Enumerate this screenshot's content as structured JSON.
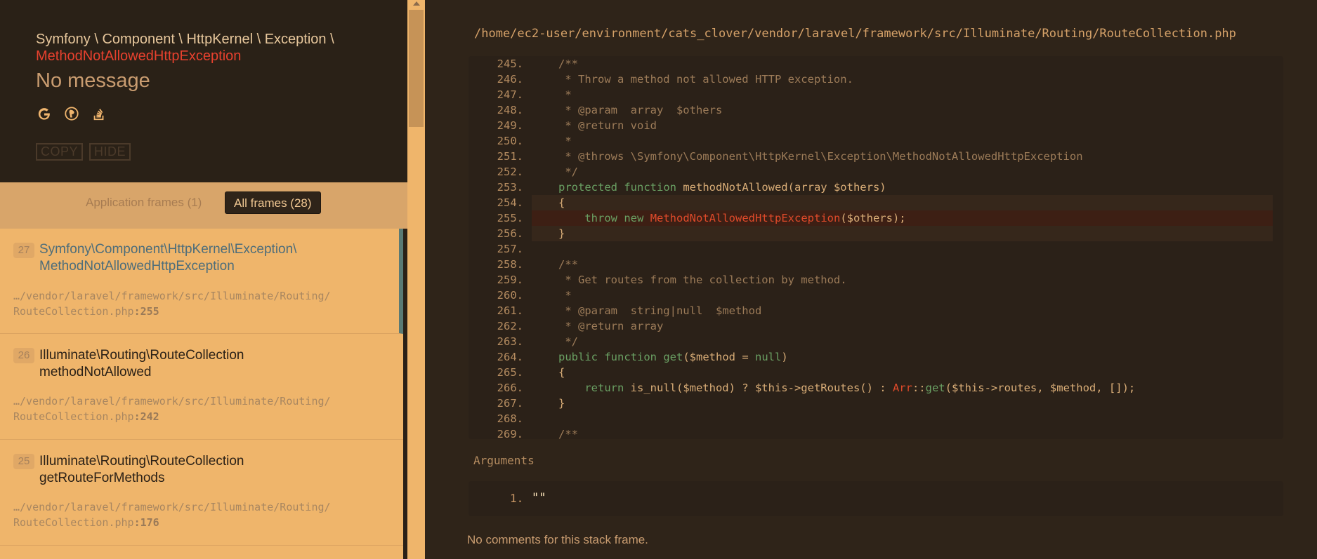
{
  "exception": {
    "namespace": "Symfony \\ Component \\ HttpKernel \\ Exception \\",
    "class": "MethodNotAllowedHttpException",
    "message": "No message"
  },
  "header_icons": [
    "google-search-icon",
    "duckduckgo-search-icon",
    "stackoverflow-search-icon"
  ],
  "buttons": {
    "copy": "COPY",
    "hide": "HIDE"
  },
  "filters": {
    "application": "Application frames (1)",
    "all": "All frames (28)"
  },
  "frames": [
    {
      "num": "27",
      "class": "Symfony\\Component\\HttpKernel\\Exception\\",
      "method": "MethodNotAllowedHttpException",
      "file": "…/vendor/laravel/framework/src/Illuminate/Routing/",
      "file2": "RouteCollection.php",
      "line": ":255"
    },
    {
      "num": "26",
      "class": "Illuminate\\Routing\\RouteCollection",
      "method": "methodNotAllowed",
      "file": "…/vendor/laravel/framework/src/Illuminate/Routing/",
      "file2": "RouteCollection.php",
      "line": ":242"
    },
    {
      "num": "25",
      "class": "Illuminate\\Routing\\RouteCollection",
      "method": "getRouteForMethods",
      "file": "…/vendor/laravel/framework/src/Illuminate/Routing/",
      "file2": "RouteCollection.php",
      "line": ":176"
    }
  ],
  "file_path": "/home/ec2-user/environment/cats_clover/vendor/laravel/framework/src/Illuminate/Routing/RouteCollection.php",
  "code": {
    "line_numbers": [
      "245.",
      "246.",
      "247.",
      "248.",
      "249.",
      "250.",
      "251.",
      "252.",
      "253.",
      "254.",
      "255.",
      "256.",
      "257.",
      "258.",
      "259.",
      "260.",
      "261.",
      "262.",
      "263.",
      "264.",
      "265.",
      "266.",
      "267.",
      "268.",
      "269."
    ],
    "highlighted_line": "255.",
    "lines": {
      "l245": "/**",
      "l246": " * Throw a method not allowed HTTP exception.",
      "l247": " *",
      "l248": " * @param  array  $others",
      "l249": " * @return void",
      "l250": " *",
      "l251": " * @throws \\Symfony\\Component\\HttpKernel\\Exception\\MethodNotAllowedHttpException",
      "l252": " */",
      "l253_kw1": "protected",
      "l253_kw2": "function",
      "l253_rest": " methodNotAllowed(array $others)",
      "l254": "{",
      "l255_kw1": "throw",
      "l255_kw2": "new",
      "l255_cls": "MethodNotAllowedHttpException",
      "l255_rest": "($others);",
      "l256": "}",
      "l257": "",
      "l258": "/**",
      "l259": " * Get routes from the collection by method.",
      "l260": " *",
      "l261": " * @param  string|null  $method",
      "l262": " * @return array",
      "l263": " */",
      "l264_kw1": "public",
      "l264_kw2": "function",
      "l264_fn": "get",
      "l264_mid": "($method = ",
      "l264_null": "null",
      "l264_end": ")",
      "l265": "{",
      "l266_kw": "return",
      "l266_a": " is_null($method) ? $this->getRoutes() : ",
      "l266_cls": "Arr",
      "l266_sep": "::",
      "l266_fn": "get",
      "l266_b": "($this->routes, $method, []);",
      "l267": "}",
      "l268": "",
      "l269": "/**"
    }
  },
  "arguments": {
    "title": "Arguments",
    "items": [
      {
        "num": "1.",
        "value": "\"\""
      }
    ]
  },
  "no_comments": "No comments for this stack frame.",
  "colors": {
    "accent": "#efb56b",
    "error": "#e8412e",
    "background": "#2f2419"
  }
}
